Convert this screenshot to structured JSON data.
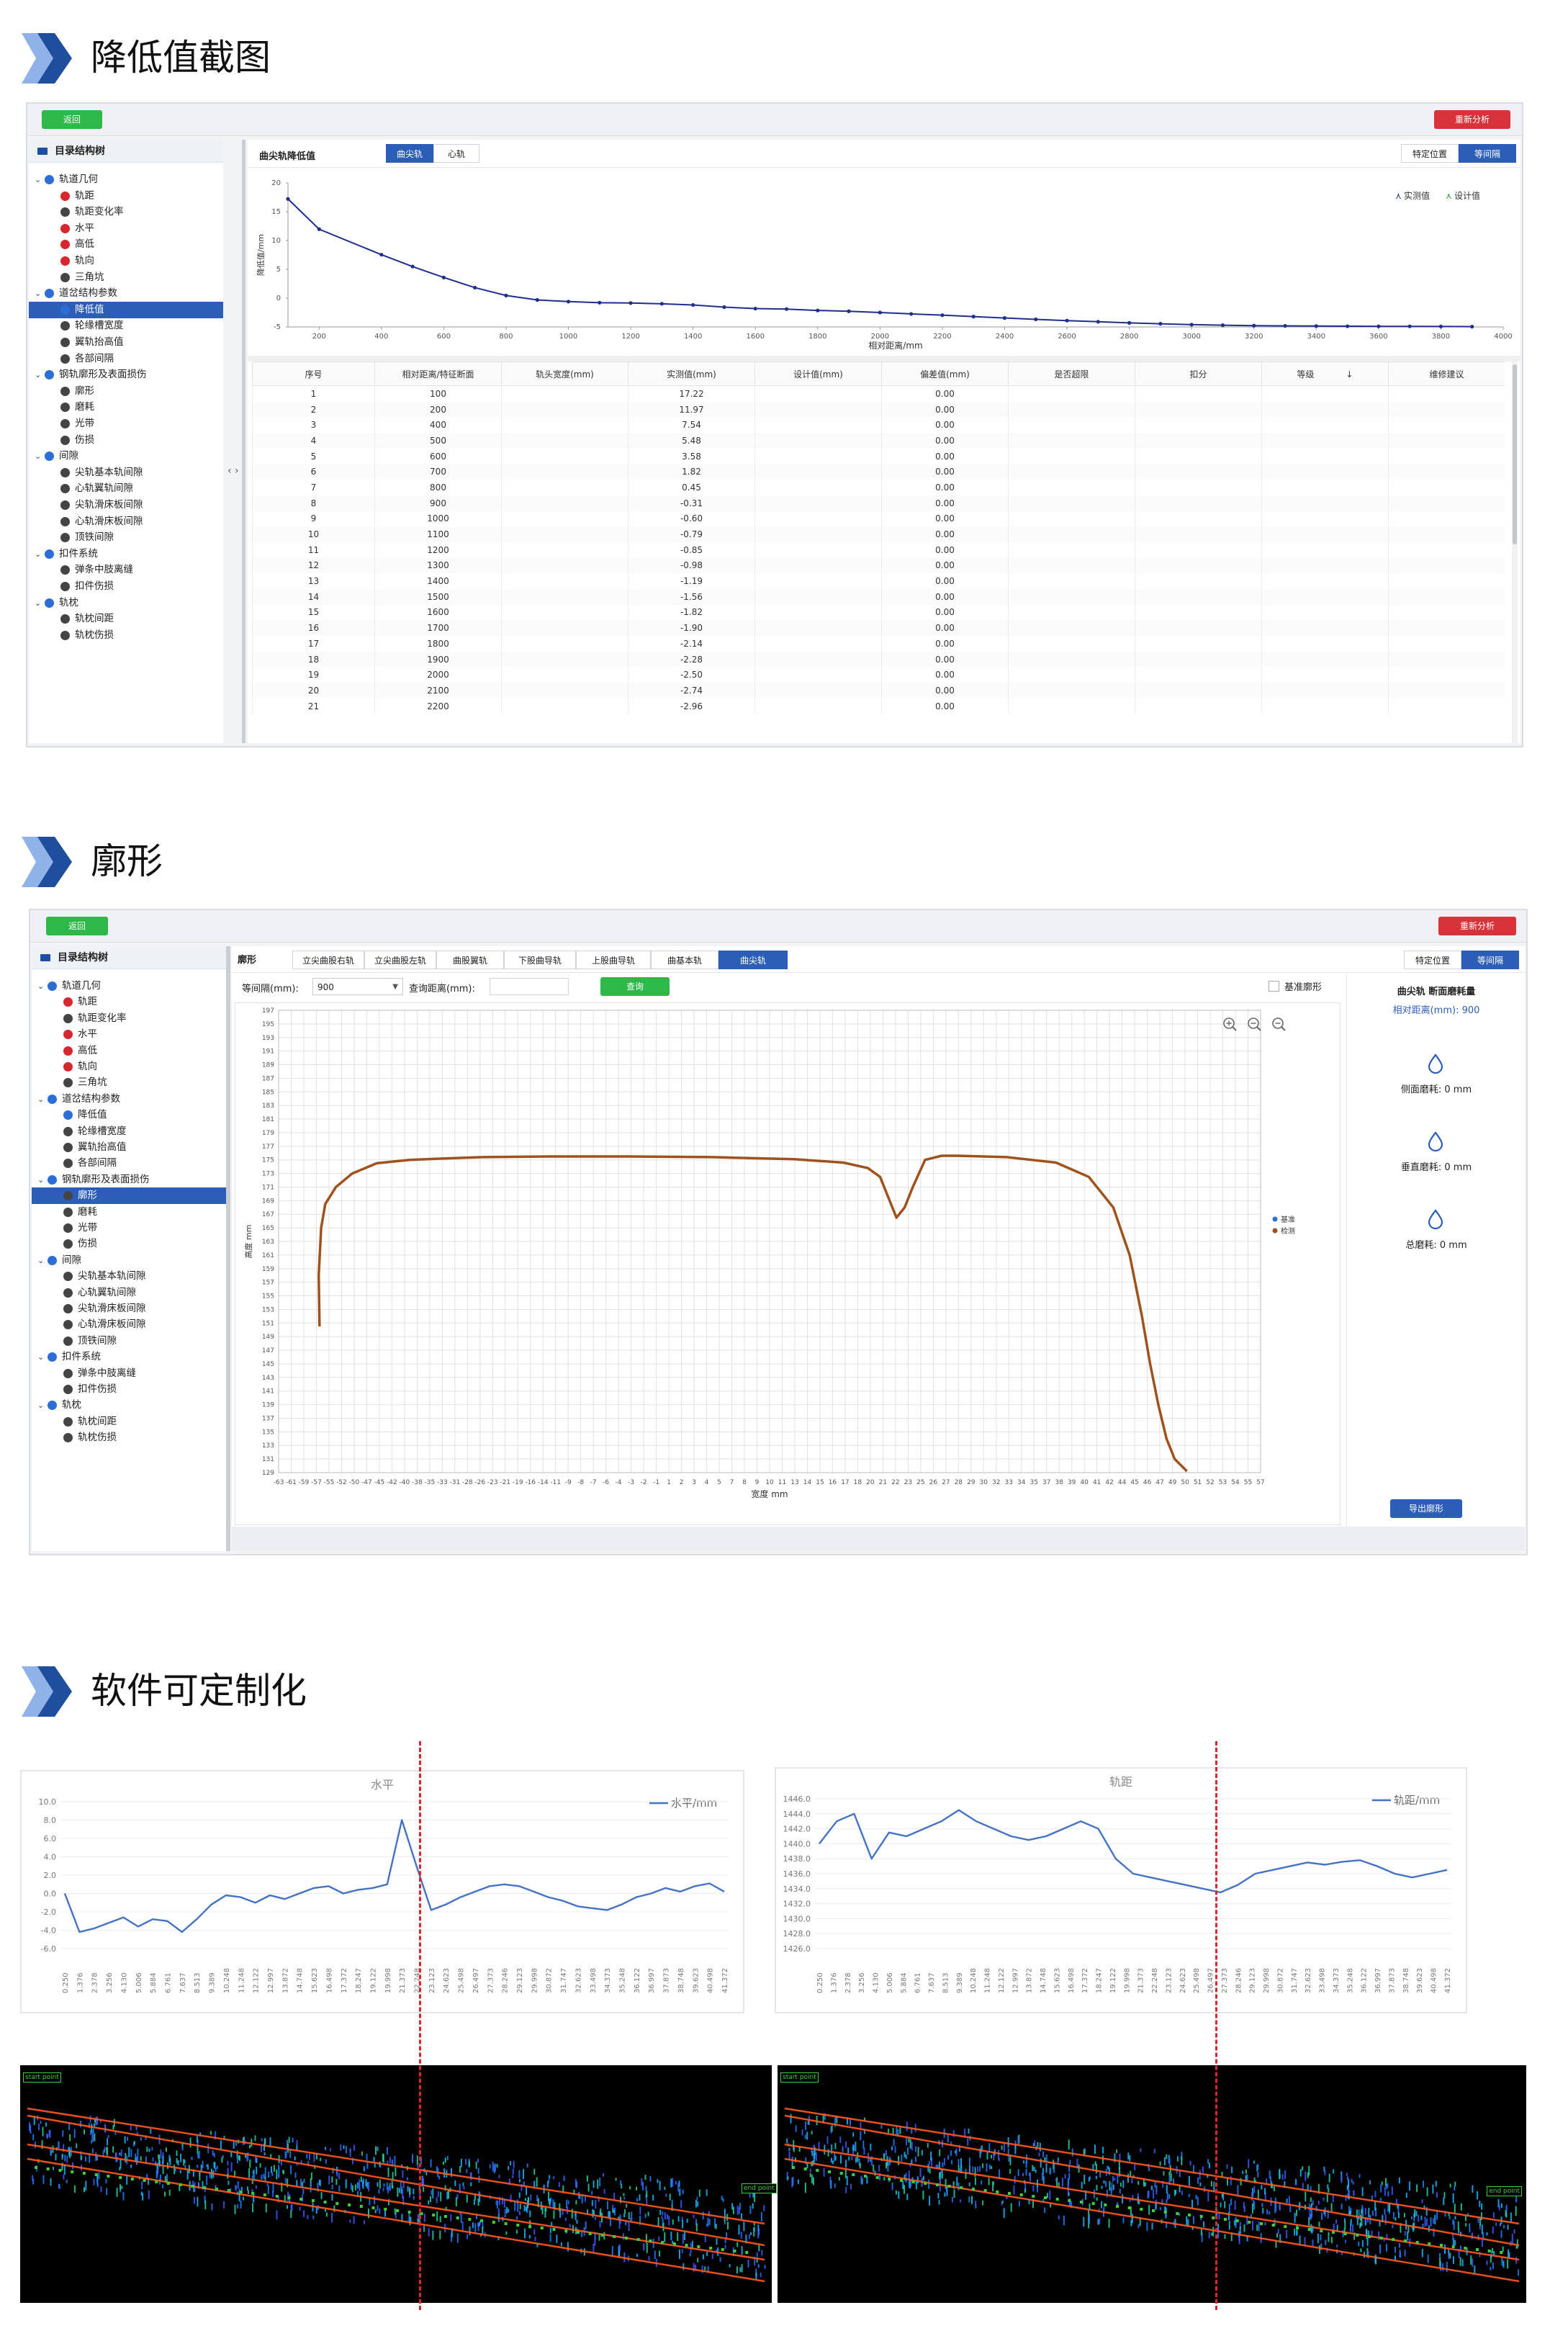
{
  "sections": [
    {
      "title": "降低值截图"
    },
    {
      "title": "廓形"
    },
    {
      "title": "软件可定制化"
    }
  ],
  "app1": {
    "back_button": "返回",
    "reanalyze_button": "重新分析",
    "tree_title": "目录结构树",
    "pane_title": "曲尖轨降低值",
    "tabs": [
      "曲尖轨",
      "心轨"
    ],
    "active_tab": 0,
    "view_toggle": [
      "特定位置",
      "等间隔"
    ],
    "active_view": 1,
    "chart_data": {
      "type": "line",
      "x": [
        100,
        200,
        400,
        500,
        600,
        700,
        800,
        900,
        1000,
        1100,
        1200,
        1300,
        1400,
        1500,
        1600,
        1700,
        1800,
        1900,
        2000,
        2100,
        2200,
        2300,
        2400,
        2500,
        2600,
        2700,
        2800,
        2900,
        3000,
        3100,
        3200,
        3300,
        3400,
        3500,
        3600,
        3700,
        3800,
        3900
      ],
      "series": [
        {
          "name": "实测值",
          "values": [
            17.22,
            11.97,
            7.54,
            5.48,
            3.58,
            1.82,
            0.45,
            -0.31,
            -0.6,
            -0.79,
            -0.85,
            -0.98,
            -1.19,
            -1.56,
            -1.82,
            -1.9,
            -2.14,
            -2.28,
            -2.5,
            -2.74,
            -2.96,
            -3.2,
            -3.45,
            -3.68,
            -3.9,
            -4.1,
            -4.3,
            -4.45,
            -4.6,
            -4.7,
            -4.78,
            -4.82,
            -4.85,
            -4.88,
            -4.9,
            -4.9,
            -4.92,
            -4.95
          ]
        },
        {
          "name": "设计值",
          "values": []
        }
      ],
      "xlabel": "相对距离/mm",
      "ylabel": "降低值/mm",
      "x_ticks": [
        200,
        400,
        600,
        800,
        1000,
        1200,
        1400,
        1600,
        1800,
        2000,
        2200,
        2400,
        2600,
        2800,
        3000,
        3200,
        3400,
        3600,
        3800,
        4000
      ],
      "y_ticks": [
        20,
        15,
        10,
        5,
        0,
        -5
      ],
      "xlim": [
        100,
        4000
      ],
      "ylim": [
        -5,
        20
      ],
      "legend_position": "top-right"
    },
    "table": {
      "headers": [
        "序号",
        "相对距离/特征断面",
        "轨头宽度(mm)",
        "实测值(mm)",
        "设计值(mm)",
        "偏差值(mm)",
        "是否超限",
        "扣分",
        "等级",
        "维修建议"
      ],
      "rows": [
        [
          "1",
          "100",
          "",
          "17.22",
          "",
          "0.00",
          "",
          "",
          "",
          ""
        ],
        [
          "2",
          "200",
          "",
          "11.97",
          "",
          "0.00",
          "",
          "",
          "",
          ""
        ],
        [
          "3",
          "400",
          "",
          "7.54",
          "",
          "0.00",
          "",
          "",
          "",
          ""
        ],
        [
          "4",
          "500",
          "",
          "5.48",
          "",
          "0.00",
          "",
          "",
          "",
          ""
        ],
        [
          "5",
          "600",
          "",
          "3.58",
          "",
          "0.00",
          "",
          "",
          "",
          ""
        ],
        [
          "6",
          "700",
          "",
          "1.82",
          "",
          "0.00",
          "",
          "",
          "",
          ""
        ],
        [
          "7",
          "800",
          "",
          "0.45",
          "",
          "0.00",
          "",
          "",
          "",
          ""
        ],
        [
          "8",
          "900",
          "",
          "-0.31",
          "",
          "0.00",
          "",
          "",
          "",
          ""
        ],
        [
          "9",
          "1000",
          "",
          "-0.60",
          "",
          "0.00",
          "",
          "",
          "",
          ""
        ],
        [
          "10",
          "1100",
          "",
          "-0.79",
          "",
          "0.00",
          "",
          "",
          "",
          ""
        ],
        [
          "11",
          "1200",
          "",
          "-0.85",
          "",
          "0.00",
          "",
          "",
          "",
          ""
        ],
        [
          "12",
          "1300",
          "",
          "-0.98",
          "",
          "0.00",
          "",
          "",
          "",
          ""
        ],
        [
          "13",
          "1400",
          "",
          "-1.19",
          "",
          "0.00",
          "",
          "",
          "",
          ""
        ],
        [
          "14",
          "1500",
          "",
          "-1.56",
          "",
          "0.00",
          "",
          "",
          "",
          ""
        ],
        [
          "15",
          "1600",
          "",
          "-1.82",
          "",
          "0.00",
          "",
          "",
          "",
          ""
        ],
        [
          "16",
          "1700",
          "",
          "-1.90",
          "",
          "0.00",
          "",
          "",
          "",
          ""
        ],
        [
          "17",
          "1800",
          "",
          "-2.14",
          "",
          "0.00",
          "",
          "",
          "",
          ""
        ],
        [
          "18",
          "1900",
          "",
          "-2.28",
          "",
          "0.00",
          "",
          "",
          "",
          ""
        ],
        [
          "19",
          "2000",
          "",
          "-2.50",
          "",
          "0.00",
          "",
          "",
          "",
          ""
        ],
        [
          "20",
          "2100",
          "",
          "-2.74",
          "",
          "0.00",
          "",
          "",
          "",
          ""
        ],
        [
          "21",
          "2200",
          "",
          "-2.96",
          "",
          "0.00",
          "",
          "",
          "",
          ""
        ]
      ]
    }
  },
  "tree": [
    {
      "label": "轨道几何",
      "level": 0,
      "color": "#2b6fd6",
      "caret": "v"
    },
    {
      "label": "轨距",
      "level": 1,
      "color": "#d8262d"
    },
    {
      "label": "轨距变化率",
      "level": 1,
      "color": "#444444"
    },
    {
      "label": "水平",
      "level": 1,
      "color": "#d8262d"
    },
    {
      "label": "高低",
      "level": 1,
      "color": "#d8262d"
    },
    {
      "label": "轨向",
      "level": 1,
      "color": "#d8262d"
    },
    {
      "label": "三角坑",
      "level": 1,
      "color": "#444444"
    },
    {
      "label": "道岔结构参数",
      "level": 0,
      "color": "#2b6fd6",
      "caret": "v"
    },
    {
      "label": "降低值",
      "level": 1,
      "color": "#2b6fd6"
    },
    {
      "label": "轮缘槽宽度",
      "level": 1,
      "color": "#444444"
    },
    {
      "label": "翼轨抬高值",
      "level": 1,
      "color": "#444444"
    },
    {
      "label": "各部间隔",
      "level": 1,
      "color": "#444444"
    },
    {
      "label": "钢轨廓形及表面损伤",
      "level": 0,
      "color": "#2b6fd6",
      "caret": "v"
    },
    {
      "label": "廓形",
      "level": 1,
      "color": "#444444"
    },
    {
      "label": "磨耗",
      "level": 1,
      "color": "#444444"
    },
    {
      "label": "光带",
      "level": 1,
      "color": "#444444"
    },
    {
      "label": "伤损",
      "level": 1,
      "color": "#444444"
    },
    {
      "label": "间隙",
      "level": 0,
      "color": "#2b6fd6",
      "caret": "v"
    },
    {
      "label": "尖轨基本轨间隙",
      "level": 1,
      "color": "#444444"
    },
    {
      "label": "心轨翼轨间隙",
      "level": 1,
      "color": "#444444"
    },
    {
      "label": "尖轨滑床板间隙",
      "level": 1,
      "color": "#444444"
    },
    {
      "label": "心轨滑床板间隙",
      "level": 1,
      "color": "#444444"
    },
    {
      "label": "顶铁间隙",
      "level": 1,
      "color": "#444444"
    },
    {
      "label": "扣件系统",
      "level": 0,
      "color": "#2b6fd6",
      "caret": "v"
    },
    {
      "label": "弹条中肢离缝",
      "level": 1,
      "color": "#444444"
    },
    {
      "label": "扣件伤损",
      "level": 1,
      "color": "#444444"
    },
    {
      "label": "轨枕",
      "level": 0,
      "color": "#2b6fd6",
      "caret": "v"
    },
    {
      "label": "轨枕间距",
      "level": 1,
      "color": "#444444"
    },
    {
      "label": "轨枕伤损",
      "level": 1,
      "color": "#444444"
    }
  ],
  "app2": {
    "back_button": "返回",
    "reanalyze_button": "重新分析",
    "tree_title": "目录结构树",
    "pane_title": "廓形",
    "tabs": [
      "立尖曲股右轨",
      "立尖曲股左轨",
      "曲股翼轨",
      "下股曲导轨",
      "上股曲导轨",
      "曲基本轨",
      "曲尖轨"
    ],
    "active_tab": 6,
    "view_toggle": [
      "特定位置",
      "等间隔"
    ],
    "active_view": 1,
    "interval_label": "等间隔(mm):",
    "interval_value": "900",
    "query_label": "查询距离(mm):",
    "query_placeholder": "",
    "query_button": "查询",
    "baseline_checkbox": "基准廓形",
    "right_title": "曲尖轨 断面磨耗量",
    "right_distance": "相对距离(mm): 900",
    "wear_items": [
      "侧面磨耗: 0 mm",
      "垂直磨耗: 0 mm",
      "总磨耗: 0 mm"
    ],
    "export_button": "导出廓形",
    "chart_data": {
      "type": "line",
      "xlabel": "宽度 mm",
      "ylabel": "高度 mm",
      "xlim": [
        -63,
        57
      ],
      "ylim": [
        129,
        197
      ],
      "grid": true,
      "legend_position": "right",
      "series": [
        {
          "name": "基准",
          "color": "#2b6fd6",
          "values": []
        },
        {
          "name": "检测",
          "color": "#a0521d",
          "x": [
            -58,
            -58.1,
            -57.8,
            -57.3,
            -56,
            -54,
            -51,
            -47,
            -43,
            -38,
            -30,
            -20,
            -10,
            0,
            6,
            9,
            10.5,
            11.5,
            12.5,
            13.5,
            14.5,
            16,
            18,
            20,
            26,
            32,
            36,
            39,
            41,
            42.5,
            43.5,
            44.5,
            45.5,
            46.5,
            48
          ],
          "values": [
            150.5,
            158,
            165,
            168.5,
            171,
            173,
            174.5,
            175,
            175.2,
            175.4,
            175.5,
            175.5,
            175.4,
            175.1,
            174.6,
            173.8,
            172.5,
            169.5,
            166.5,
            168,
            171,
            175,
            175.6,
            175.6,
            175.4,
            174.6,
            172.5,
            168,
            161,
            152,
            145,
            139,
            134,
            131,
            129.2
          ]
        }
      ],
      "x_tick_labels": [
        "-63",
        "-61",
        "-59",
        "-57",
        "-55",
        "-52",
        "-50",
        "-47",
        "-45",
        "-42",
        "-40",
        "-38",
        "-35",
        "-33",
        "-31",
        "-28",
        "-26",
        "-23",
        "-21",
        "-19",
        "-16",
        "-14",
        "-11",
        "-9",
        "-8",
        "-7",
        "-6",
        "-4",
        "-3",
        "-2",
        "-1",
        "1",
        "2",
        "3",
        "4",
        "5",
        "7",
        "8",
        "9",
        "10",
        "11",
        "13",
        "14",
        "15",
        "16",
        "17",
        "18",
        "20",
        "21",
        "22",
        "23",
        "25",
        "26",
        "27",
        "28",
        "29",
        "30",
        "32",
        "33",
        "34",
        "35",
        "37",
        "38",
        "39",
        "40",
        "41",
        "42",
        "44",
        "45",
        "46",
        "47",
        "49",
        "50",
        "51",
        "52",
        "53",
        "54",
        "55",
        "57"
      ],
      "y_tick_labels": [
        "197",
        "195",
        "193",
        "191",
        "189",
        "187",
        "185",
        "183",
        "181",
        "179",
        "177",
        "175",
        "173",
        "171",
        "169",
        "167",
        "165",
        "163",
        "161",
        "159",
        "157",
        "155",
        "153",
        "151",
        "149",
        "147",
        "145",
        "143",
        "141",
        "139",
        "137",
        "135",
        "133",
        "131",
        "129"
      ]
    }
  },
  "charts_bottom": [
    {
      "type": "line",
      "title": "水平",
      "legend": "水平/mm",
      "ylim": [
        -6,
        10
      ],
      "y_ticks": [
        "10.0",
        "8.0",
        "6.0",
        "4.0",
        "2.0",
        "0.0",
        "-2.0",
        "-4.0",
        "-6.0"
      ],
      "x_labels": [
        "0.250",
        "1.376",
        "2.378",
        "3.256",
        "4.130",
        "5.006",
        "5.884",
        "6.761",
        "7.637",
        "8.513",
        "9.389",
        "10.248",
        "11.248",
        "12.122",
        "12.997",
        "13.872",
        "14.748",
        "15.623",
        "16.498",
        "17.372",
        "18.247",
        "19.122",
        "19.998",
        "21.373",
        "22.248",
        "23.123",
        "24.623",
        "25.498",
        "26.497",
        "27.373",
        "28.246",
        "29.123",
        "29.998",
        "30.872",
        "31.747",
        "32.623",
        "33.498",
        "34.373",
        "35.248",
        "36.122",
        "36.997",
        "37.873",
        "38.748",
        "39.623",
        "40.498",
        "41.372"
      ],
      "values": [
        0.0,
        -4.2,
        -3.8,
        -3.2,
        -2.6,
        -3.6,
        -2.8,
        -3.0,
        -4.2,
        -2.8,
        -1.2,
        -0.2,
        -0.4,
        -1.0,
        -0.2,
        -0.6,
        0.0,
        0.6,
        0.8,
        0.0,
        0.4,
        0.6,
        1.0,
        8.0,
        3.0,
        -1.8,
        -1.2,
        -0.4,
        0.2,
        0.8,
        1.0,
        0.8,
        0.2,
        -0.4,
        -0.8,
        -1.4,
        -1.6,
        -1.8,
        -1.2,
        -0.4,
        0.0,
        0.6,
        0.2,
        0.8,
        1.1,
        0.2
      ],
      "marker_index": 23,
      "color": "#4472c4"
    },
    {
      "type": "line",
      "title": "轨距",
      "legend": "轨距/mm",
      "ylim": [
        1426,
        1446
      ],
      "y_ticks": [
        "1446.0",
        "1444.0",
        "1442.0",
        "1440.0",
        "1438.0",
        "1436.0",
        "1434.0",
        "1432.0",
        "1430.0",
        "1428.0",
        "1426.0"
      ],
      "x_labels": [
        "0.250",
        "1.376",
        "2.378",
        "3.256",
        "4.130",
        "5.006",
        "5.884",
        "6.761",
        "7.637",
        "8.513",
        "9.389",
        "10.248",
        "11.248",
        "12.122",
        "12.997",
        "13.872",
        "14.748",
        "15.623",
        "16.498",
        "17.372",
        "18.247",
        "19.122",
        "19.998",
        "21.373",
        "22.248",
        "23.123",
        "24.623",
        "25.498",
        "26.497",
        "27.373",
        "28.246",
        "29.123",
        "29.998",
        "30.872",
        "31.747",
        "32.623",
        "33.498",
        "34.373",
        "35.248",
        "36.122",
        "36.997",
        "37.873",
        "38.748",
        "39.623",
        "40.498",
        "41.372"
      ],
      "values": [
        1440.0,
        1443.0,
        1444.0,
        1438.0,
        1441.5,
        1441.0,
        1442.0,
        1443.0,
        1444.5,
        1443.0,
        1442.0,
        1441.0,
        1440.5,
        1441.0,
        1442.0,
        1443.0,
        1442.0,
        1438.0,
        1436.0,
        1435.5,
        1435.0,
        1434.5,
        1434.0,
        1433.5,
        1434.5,
        1436.0,
        1436.5,
        1437.0,
        1437.5,
        1437.2,
        1437.6,
        1437.8,
        1437.0,
        1436.0,
        1435.5,
        1436.0,
        1436.5
      ],
      "marker_index": 22,
      "color": "#4472c4"
    }
  ],
  "pointclouds": [
    {
      "start_label": "start point",
      "end_label": "end point"
    },
    {
      "start_label": "start point",
      "end_label": "end point"
    }
  ]
}
